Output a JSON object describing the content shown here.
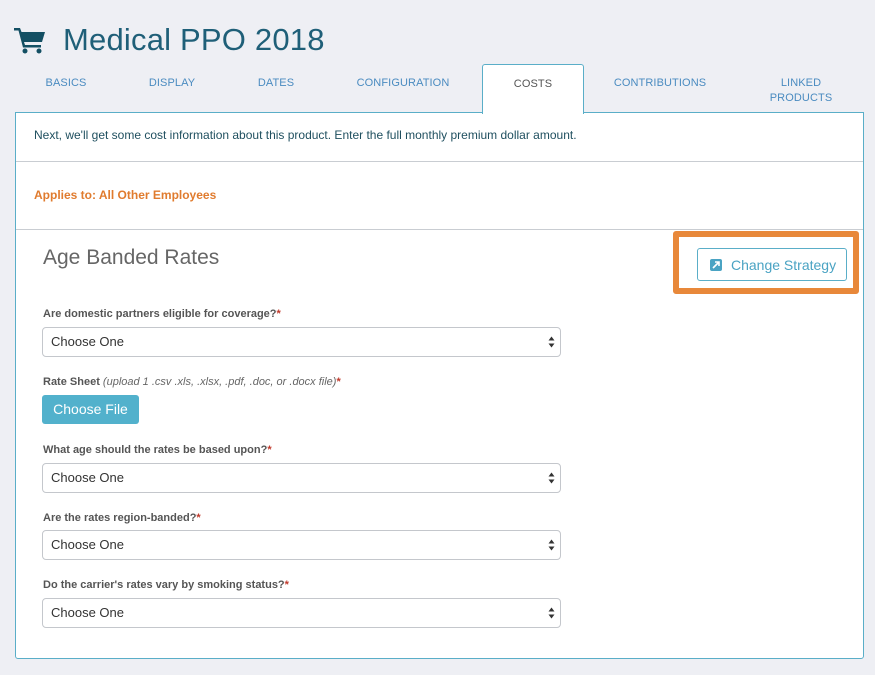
{
  "header": {
    "icon": "shopping-cart-icon",
    "title": "Medical PPO 2018"
  },
  "tabs": [
    {
      "label": "BASICS",
      "active": false
    },
    {
      "label": "DISPLAY",
      "active": false
    },
    {
      "label": "DATES",
      "active": false
    },
    {
      "label": "CONFIGURATION",
      "active": false
    },
    {
      "label": "COSTS",
      "active": true
    },
    {
      "label": "CONTRIBUTIONS",
      "active": false
    },
    {
      "label": "LINKED",
      "label2": "PRODUCTS",
      "active": false
    }
  ],
  "intro_text": "Next, we'll get some cost information about this product. Enter the full monthly premium dollar amount.",
  "applies_to": "Applies to: All Other Employees",
  "section": {
    "title": "Age Banded Rates",
    "change_strategy_label": "Change Strategy",
    "change_strategy_icon": "external-link-icon",
    "highlight_color": "#e8883a"
  },
  "fields": {
    "domestic_partners": {
      "label": "Are domestic partners eligible for coverage?",
      "required": "*",
      "value": "Choose One"
    },
    "rate_sheet": {
      "label": "Rate Sheet",
      "hint": "(upload 1 .csv .xls, .xlsx, .pdf, .doc, or .docx file)",
      "required": "*",
      "button_label": "Choose File"
    },
    "age_basis": {
      "label": "What age should the rates be based upon?",
      "required": "*",
      "value": "Choose One"
    },
    "region_banded": {
      "label": "Are the rates region-banded?",
      "required": "*",
      "value": "Choose One"
    },
    "smoking_status": {
      "label": "Do the carrier's rates vary by smoking status?",
      "required": "*",
      "value": "Choose One"
    }
  },
  "colors": {
    "title": "#1f5f78",
    "tab_link": "#4a8bc0",
    "accent": "#52b1cc",
    "applies_orange": "#e07b2e",
    "required_red": "#c0392b"
  }
}
